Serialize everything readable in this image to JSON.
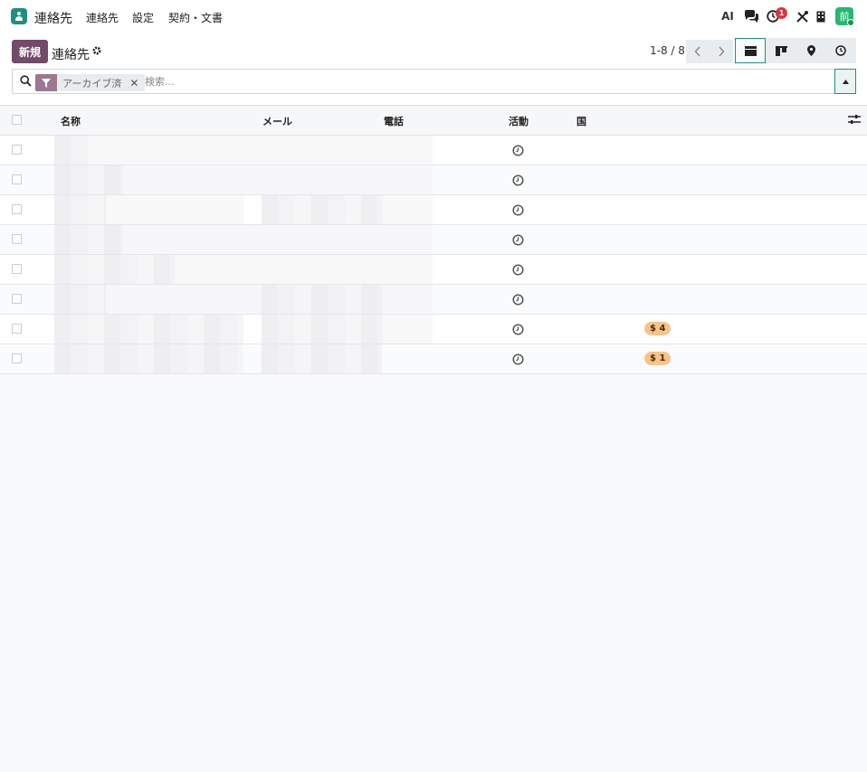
{
  "navbar": {
    "app_name": "連絡先",
    "menu": [
      "連絡先",
      "設定",
      "契約・文書"
    ],
    "ai_label": "AI",
    "activity_count": "1",
    "avatar_initial": "前"
  },
  "control": {
    "new_button": "新規",
    "breadcrumb": "連絡先",
    "pager": "1-8 / 8"
  },
  "search": {
    "facet_label": "アーカイブ済",
    "placeholder": "検索..."
  },
  "table": {
    "columns": [
      "名称",
      "メール",
      "電話",
      "活動",
      "国"
    ],
    "rows": [
      {
        "tag": ""
      },
      {
        "tag": ""
      },
      {
        "tag": ""
      },
      {
        "tag": ""
      },
      {
        "tag": ""
      },
      {
        "tag": ""
      },
      {
        "tag": "$ 4"
      },
      {
        "tag": "$ 1"
      }
    ]
  },
  "colors": {
    "brand": "#714b67",
    "accent": "#1f8f7f",
    "tag_bg": "#f6c38f",
    "badge": "#d9363e"
  }
}
